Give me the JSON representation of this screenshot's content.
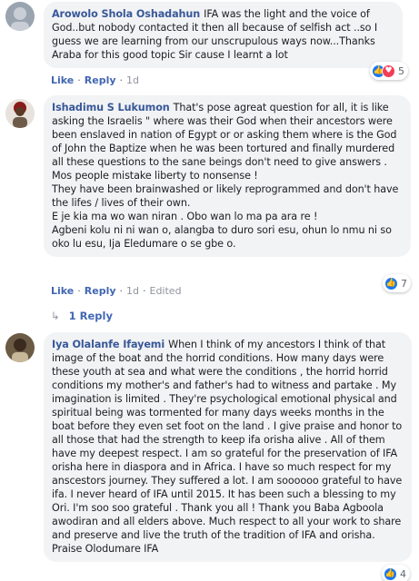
{
  "comments": [
    {
      "author": "Arowolo Shola Oshadahun",
      "text": "IFA was the light and the voice of God..but nobody contacted it then all because of selfish act ..so I guess we are learning from our unscrupulous ways now...Thanks Araba for this good topic Sir cause I learnt a lot",
      "actions": {
        "like": "Like",
        "reply": "Reply",
        "time": "1d"
      },
      "reactions": {
        "types": [
          "like-icon",
          "love-icon"
        ],
        "count": "5"
      }
    },
    {
      "author": "Ishadimu S Lukumon",
      "text_lines": [
        "That's pose agreat question for all, it is like asking the Israelis \" where was their God when their ancestors were been enslaved in nation of Egypt or or asking them where is the God of John the Baptize when he was been tortured and finally murdered all these questions to the sane beings don't need to give answers .",
        "Mos people mistake liberty to nonsense !",
        "They have been brainwashed or likely reprogrammed and don't have the lifes / lives of their own.",
        "E je kia ma wo wan niran . Obo wan lo ma pa ara re !",
        "Agbeni kolu ni ni wan o, alangba to duro sori esu, ohun lo nmu ni so oko lu esu, Ija Eledumare o se gbe o."
      ],
      "actions": {
        "like": "Like",
        "reply": "Reply",
        "time": "1d",
        "edited": "Edited"
      },
      "reactions": {
        "types": [
          "like-icon"
        ],
        "count": "7"
      },
      "replies_link": "1 Reply"
    },
    {
      "author": "Iya Olalanfe Ifayemi",
      "text": "When I think of my ancestors I think of that image of the boat and the horrid conditions. How many days were these youth at sea and what were the conditions , the horrid horrid conditions my mother's and father's had to witness and partake . My imagination is limited . They're psychological emotional physical and spiritual being was tormented for many days weeks months in the boat before they even set foot on the land . I give praise and honor to all those that had the strength to keep ifa orisha alive . All of them have my deepest respect. I am so grateful for the preservation of IFA orisha here in diaspora and in Africa. I have so much respect for my anscestors journey. They suffered a lot. I am soooooo grateful to have ifa. I never heard of IFA until 2015. It has been such a blessing to my Ori. I'm soo soo grateful . Thank you all ! Thank you Baba Agboola awodiran and all elders above. Much respect to all your work to share and preserve and live the truth of the tradition of IFA and orisha. Praise Olodumare IFA",
      "reactions": {
        "types": [
          "like-icon"
        ],
        "count": "4"
      }
    }
  ],
  "colors": {
    "link": "#385898",
    "bubble": "#f2f3f5",
    "like": "#1877f2",
    "love": "#f33e58"
  }
}
